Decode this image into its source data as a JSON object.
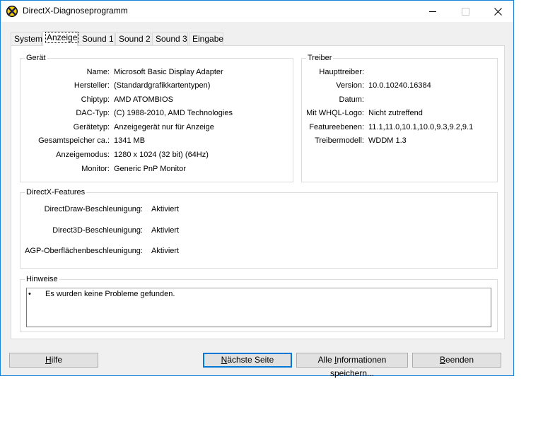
{
  "window": {
    "title": "DirectX-Diagnoseprogramm",
    "icon": "directx-icon",
    "controls": {
      "minimize_icon": "minimize-icon",
      "maximize_icon": "maximize-icon",
      "close_icon": "close-icon"
    }
  },
  "tabs": [
    {
      "label": "System",
      "active": false
    },
    {
      "label": "Anzeige",
      "active": true
    },
    {
      "label": "Sound 1",
      "active": false
    },
    {
      "label": "Sound 2",
      "active": false
    },
    {
      "label": "Sound 3",
      "active": false
    },
    {
      "label": "Eingabe",
      "active": false
    }
  ],
  "device": {
    "title": "Gerät",
    "rows": [
      {
        "label": "Name:",
        "value": "Microsoft Basic Display Adapter"
      },
      {
        "label": "Hersteller:",
        "value": "(Standardgrafikkartentypen)"
      },
      {
        "label": "Chiptyp:",
        "value": "AMD ATOMBIOS"
      },
      {
        "label": "DAC-Typ:",
        "value": "(C) 1988-2010, AMD Technologies"
      },
      {
        "label": "Gerätetyp:",
        "value": "Anzeigegerät nur für Anzeige"
      },
      {
        "label": "Gesamtspeicher ca.:",
        "value": "1341 MB"
      },
      {
        "label": "Anzeigemodus:",
        "value": "1280 x 1024 (32 bit) (64Hz)"
      },
      {
        "label": "Monitor:",
        "value": "Generic PnP Monitor"
      }
    ]
  },
  "driver": {
    "title": "Treiber",
    "rows": [
      {
        "label": "Haupttreiber:",
        "value": ""
      },
      {
        "label": "Version:",
        "value": "10.0.10240.16384"
      },
      {
        "label": "Datum:",
        "value": ""
      },
      {
        "label": "Mit WHQL-Logo:",
        "value": "Nicht zutreffend"
      },
      {
        "label": "Featureebenen:",
        "value": "11.1,11.0,10.1,10.0,9.3,9.2,9.1"
      },
      {
        "label": "Treibermodell:",
        "value": "WDDM 1.3"
      }
    ]
  },
  "features": {
    "title": "DirectX-Features",
    "rows": [
      {
        "label": "DirectDraw-Beschleunigung:",
        "value": "Aktiviert"
      },
      {
        "label": "Direct3D-Beschleunigung:",
        "value": "Aktiviert"
      },
      {
        "label": "AGP-Oberflächenbeschleunigung:",
        "value": "Aktiviert"
      }
    ]
  },
  "notes": {
    "title": "Hinweise",
    "bullet": "•",
    "items": [
      "Es wurden keine Probleme gefunden."
    ]
  },
  "buttons": {
    "help": {
      "pre": "",
      "accel": "H",
      "post": "ilfe"
    },
    "next": {
      "pre": "",
      "accel": "N",
      "post": "ächste Seite"
    },
    "save": {
      "pre": "Alle ",
      "accel": "I",
      "post": "nformationen speichern..."
    },
    "exit": {
      "pre": "",
      "accel": "B",
      "post": "eenden"
    }
  }
}
